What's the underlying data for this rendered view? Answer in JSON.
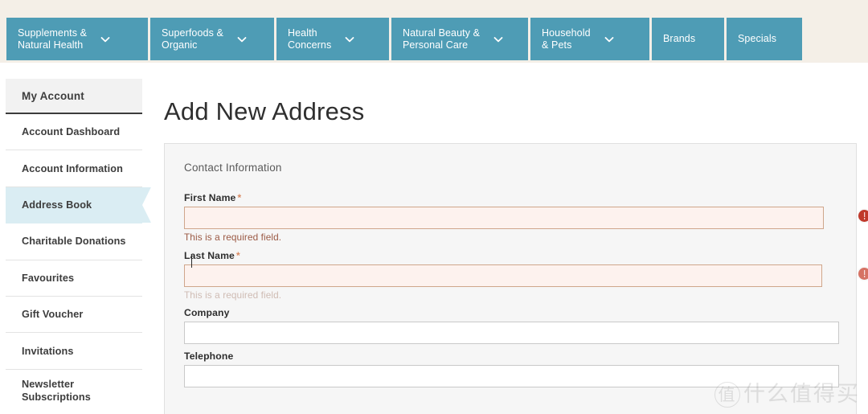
{
  "colors": {
    "nav_strip_bg": "#f4efe7",
    "nav_item_bg": "#4e9cb5",
    "sidebar_active_bg": "#daedf3",
    "panel_bg": "#f6f6f6",
    "error_red": "#c0392b",
    "error_text": "#9b5a45",
    "required_star": "#d98a63"
  },
  "topnav": {
    "items": [
      {
        "label": "Supplements &\nNatural Health",
        "has_chevron": true,
        "icon": "chevron-down-icon"
      },
      {
        "label": "Superfoods &\nOrganic",
        "has_chevron": true,
        "icon": "chevron-down-icon"
      },
      {
        "label": "Health\nConcerns",
        "has_chevron": true,
        "icon": "chevron-down-icon"
      },
      {
        "label": "Natural Beauty &\nPersonal Care",
        "has_chevron": true,
        "icon": "chevron-down-icon"
      },
      {
        "label": "Household\n& Pets",
        "has_chevron": true,
        "icon": "chevron-down-icon"
      },
      {
        "label": "Brands",
        "has_chevron": false
      },
      {
        "label": "Specials",
        "has_chevron": false
      }
    ]
  },
  "sidebar": {
    "header": "My Account",
    "items": [
      {
        "label": "Account Dashboard",
        "active": false
      },
      {
        "label": "Account Information",
        "active": false
      },
      {
        "label": "Address Book",
        "active": true
      },
      {
        "label": "Charitable Donations",
        "active": false
      },
      {
        "label": "Favourites",
        "active": false
      },
      {
        "label": "Gift Voucher",
        "active": false
      },
      {
        "label": "Invitations",
        "active": false
      },
      {
        "label": "Newsletter\nSubscriptions",
        "active": false
      }
    ]
  },
  "main": {
    "page_title": "Add New Address",
    "fieldset_legend": "Contact Information",
    "fields": [
      {
        "label": "First Name",
        "required": true,
        "required_marker": "*",
        "value": "",
        "error": "This is a required field.",
        "error_state": true,
        "error_faded": false,
        "focused": false,
        "error_icon": "error-exclamation-icon"
      },
      {
        "label": "Last Name",
        "required": true,
        "required_marker": "*",
        "value": "",
        "error": "This is a required field.",
        "error_state": true,
        "error_faded": true,
        "focused": true,
        "error_icon": "error-exclamation-icon"
      },
      {
        "label": "Company",
        "required": false,
        "required_marker": "",
        "value": "",
        "error": "",
        "error_state": false,
        "error_faded": false,
        "focused": false
      },
      {
        "label": "Telephone",
        "required": false,
        "required_marker": "",
        "value": "",
        "error": "",
        "error_state": false,
        "error_faded": false,
        "focused": false
      }
    ]
  },
  "watermark": {
    "mark": "值",
    "text": "什么值得买"
  }
}
